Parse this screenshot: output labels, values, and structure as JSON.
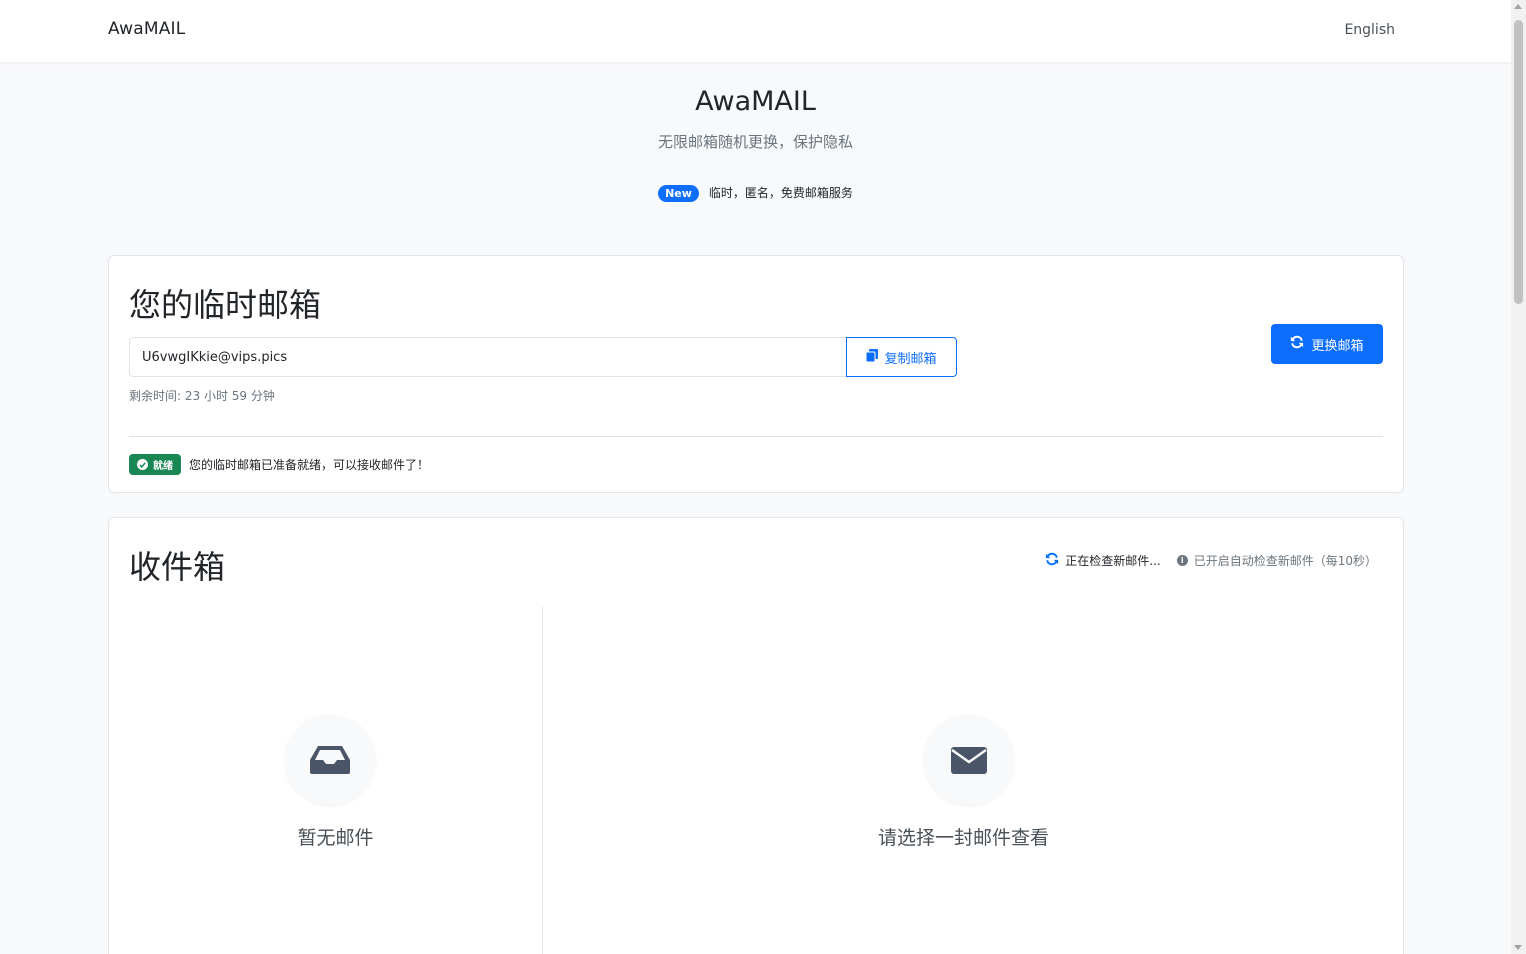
{
  "navbar": {
    "brand": "AwaMAIL",
    "language": "English"
  },
  "hero": {
    "title": "AwaMAIL",
    "subtitle": "无限邮箱随机更换，保护隐私",
    "badge": "New",
    "tagline": "临时，匿名，免费邮箱服务"
  },
  "mailbox": {
    "title": "您的临时邮箱",
    "email": "U6vwgIKkie@vips.pics",
    "copy_label": "复制邮箱",
    "change_label": "更换邮箱",
    "remaining": "剩余时间: 23 小时 59 分钟",
    "status_badge": "就绪",
    "status_text": "您的临时邮箱已准备就绪，可以接收邮件了！"
  },
  "inbox": {
    "title": "收件箱",
    "checking": "正在检查新邮件...",
    "auto_check": "已开启自动检查新邮件（每10秒）",
    "empty_list": "暂无邮件",
    "empty_view": "请选择一封邮件查看"
  },
  "colors": {
    "primary": "#0d6efd",
    "success": "#198754",
    "icon_dark": "#4a5568"
  },
  "icons": {
    "copy": "copy-icon",
    "refresh": "refresh-icon",
    "check": "check-circle-icon",
    "info": "info-icon",
    "inbox": "inbox-tray-icon",
    "envelope": "envelope-icon"
  }
}
